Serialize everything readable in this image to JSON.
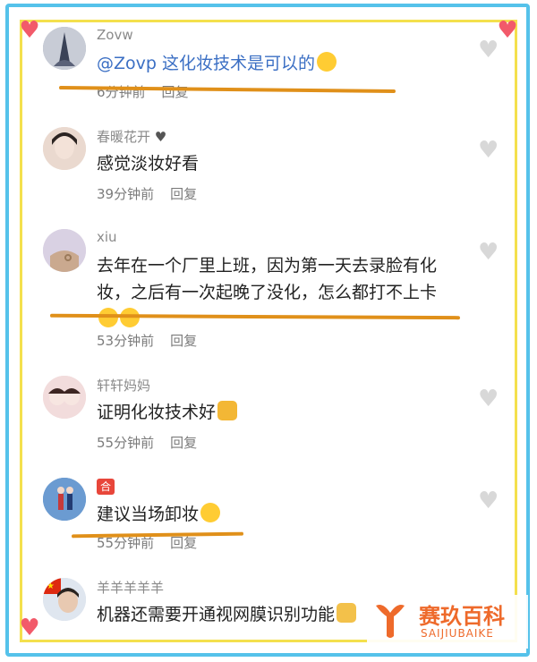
{
  "comments": [
    {
      "username": "Zovw",
      "text": "@Zovp 这化妆技术是可以的",
      "time": "6分钟前",
      "reply": "回复",
      "emoji": "flushed-face"
    },
    {
      "username": "春暖花开",
      "text": "感觉淡妆好看",
      "time": "39分钟前",
      "reply": "回复",
      "emoji": ""
    },
    {
      "username": "xiu",
      "text": "去年在一个厂里上班，因为第一天去录脸有化妆，之后有一次起晚了没化，怎么都打不上卡",
      "time": "53分钟前",
      "reply": "回复",
      "emoji": "laughing-crying-face"
    },
    {
      "username": "轩轩妈妈",
      "text": "证明化妆技术好",
      "time": "55分钟前",
      "reply": "回复",
      "emoji": "thumbs-up"
    },
    {
      "username": "",
      "badge": "合",
      "text": "建议当场卸妆",
      "time": "55分钟前",
      "reply": "回复",
      "emoji": "laughing-crying-face"
    },
    {
      "username": "羊羊羊羊羊",
      "text": "机器还需要开通视网膜识别功能",
      "time": "",
      "reply": "",
      "emoji": "fingers-crossed"
    }
  ],
  "watermark": {
    "cn": "赛玖百科",
    "en": "SAIJIUBAIKE"
  },
  "colors": {
    "outer_border": "#55c2ea",
    "inner_border": "#f4e04d",
    "underline": "#e0901a",
    "heart": "#f25a6a"
  }
}
